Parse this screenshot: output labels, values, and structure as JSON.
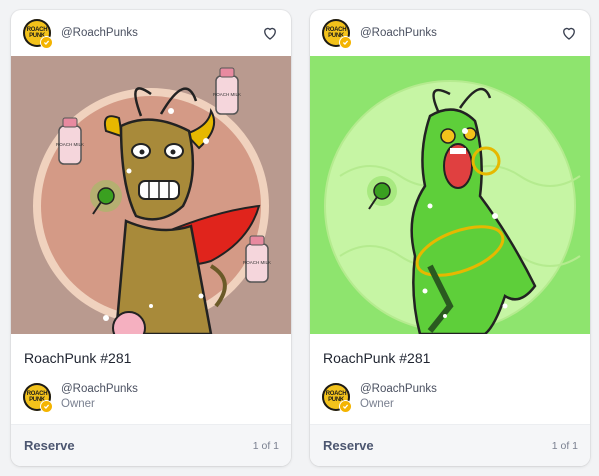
{
  "cards": [
    {
      "collection_handle": "@RoachPunks",
      "title": "RoachPunk #281",
      "owner_handle": "@RoachPunks",
      "owner_role": "Owner",
      "action_label": "Reserve",
      "edition": "1 of 1",
      "avatar_text": "ROACH PUNK",
      "art_bg": "#b99a8f",
      "bottle_label": "ROACH MILK"
    },
    {
      "collection_handle": "@RoachPunks",
      "title": "RoachPunk #281",
      "owner_handle": "@RoachPunks",
      "owner_role": "Owner",
      "action_label": "Reserve",
      "edition": "1 of 1",
      "avatar_text": "ROACH PUNK",
      "art_bg": "#8ee46e"
    }
  ]
}
